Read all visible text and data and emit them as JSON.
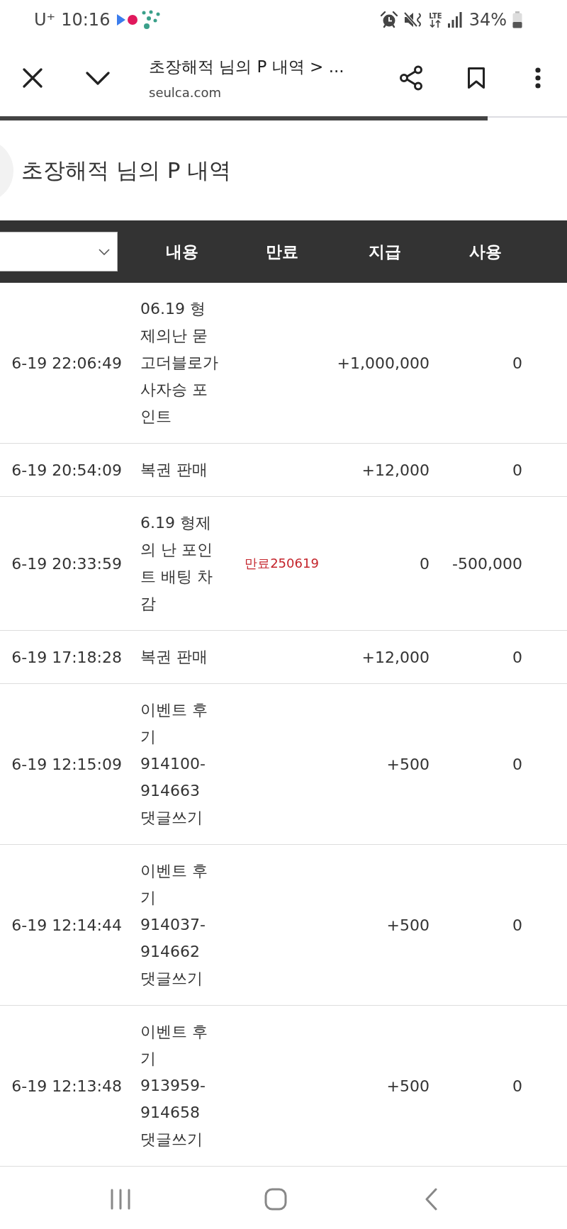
{
  "status_bar": {
    "carrier": "U⁺",
    "time": "10:16",
    "network": "LTE",
    "battery": "34%"
  },
  "browser_bar": {
    "title": "초장해적 님의 P 내역 > ...",
    "url": "seulca.com",
    "load_progress": {
      "level": 0.86
    }
  },
  "page": {
    "title": "초장해적 님의 P 내역"
  },
  "table": {
    "columns": [
      "내용",
      "만료",
      "지급",
      "사용"
    ],
    "rows": [
      {
        "date": "6-19 22:06:49",
        "content": "06.19 형제의난 묻고더블로가 사자승 포인트",
        "granted": "+1,000,000",
        "used": "0"
      },
      {
        "date": "6-19 20:54:09",
        "content": "복권 판매",
        "granted": "+12,000",
        "used": "0"
      },
      {
        "date": "6-19 20:33:59",
        "content": "6.19 형제의 난 포인트 배팅 차감",
        "expiry": "만료250619",
        "granted": "0",
        "used": "-500,000"
      },
      {
        "date": "6-19 17:18:28",
        "content": "복권 판매",
        "granted": "+12,000",
        "used": "0"
      },
      {
        "date": "6-19 12:15:09",
        "content": "이벤트 후기 914100-914663 댓글쓰기",
        "granted": "+500",
        "used": "0"
      },
      {
        "date": "6-19 12:14:44",
        "content": "이벤트 후기 914037-914662 댓글쓰기",
        "granted": "+500",
        "used": "0"
      },
      {
        "date": "6-19 12:13:48",
        "content": "이벤트 후기 913959-914658 댓글쓰기",
        "granted": "+500",
        "used": "0"
      }
    ]
  }
}
